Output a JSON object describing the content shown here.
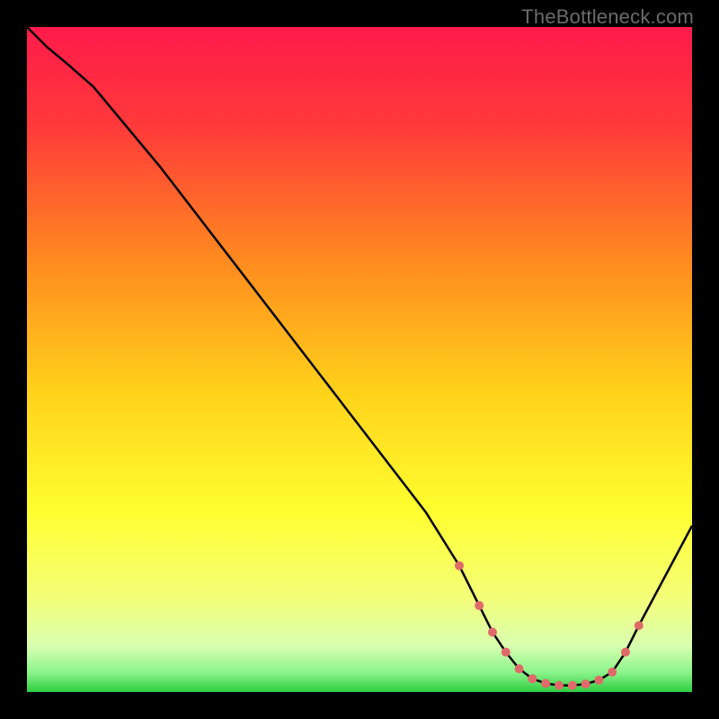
{
  "watermark": "TheBottleneck.com",
  "chart_data": {
    "type": "line",
    "title": "",
    "xlabel": "",
    "ylabel": "",
    "xlim": [
      0,
      100
    ],
    "ylim": [
      0,
      100
    ],
    "grid": false,
    "legend": false,
    "gradient_stops": [
      {
        "offset": 0.0,
        "color": "#ff1a4b"
      },
      {
        "offset": 0.15,
        "color": "#ff3a3a"
      },
      {
        "offset": 0.35,
        "color": "#ff8a1f"
      },
      {
        "offset": 0.55,
        "color": "#ffd21a"
      },
      {
        "offset": 0.73,
        "color": "#ffff30"
      },
      {
        "offset": 0.86,
        "color": "#f4ff7a"
      },
      {
        "offset": 0.93,
        "color": "#d9ffb0"
      },
      {
        "offset": 0.97,
        "color": "#8cf58c"
      },
      {
        "offset": 1.0,
        "color": "#2ecc40"
      }
    ],
    "series": [
      {
        "name": "bottleneck-curve",
        "color": "#000000",
        "x": [
          0,
          3,
          6,
          10,
          20,
          30,
          40,
          50,
          60,
          65,
          68,
          70,
          72,
          74,
          76,
          78,
          80,
          82,
          84,
          86,
          88,
          90,
          92,
          100
        ],
        "y": [
          100,
          97,
          94.5,
          91,
          79,
          66,
          53,
          40,
          27,
          19,
          13,
          9,
          6,
          3.5,
          2,
          1.3,
          1.0,
          1.0,
          1.2,
          1.8,
          3,
          6,
          10,
          25
        ]
      }
    ],
    "markers": {
      "name": "curve-dots",
      "color": "#e06a6a",
      "radius": 5,
      "x": [
        65,
        68,
        70,
        72,
        74,
        76,
        78,
        80,
        82,
        84,
        86,
        88,
        90,
        92
      ],
      "y": [
        19,
        13,
        9,
        6,
        3.5,
        2,
        1.3,
        1.0,
        1.0,
        1.2,
        1.8,
        3,
        6,
        10
      ]
    }
  }
}
